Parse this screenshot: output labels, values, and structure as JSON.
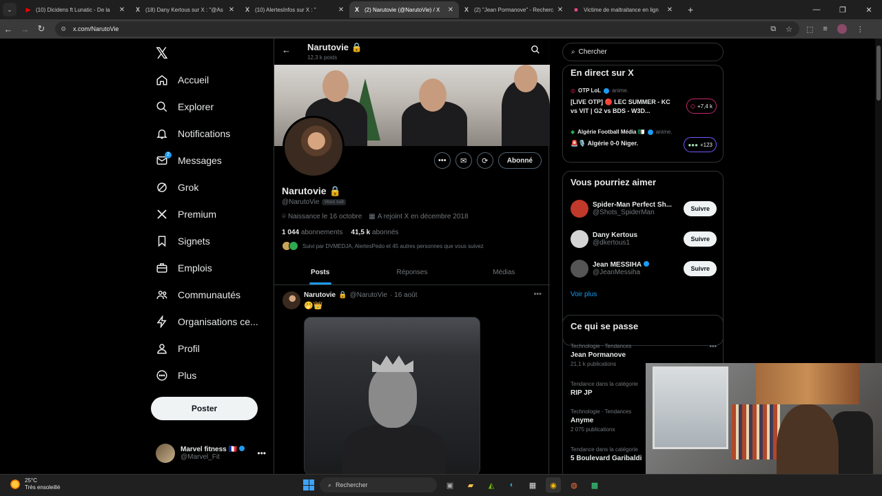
{
  "browser": {
    "tabs": [
      {
        "title": "(10) Dicidens ft Lunatic - De la",
        "favicon": "youtube-icon",
        "color": "#ff0000"
      },
      {
        "title": "(18) Dany Kertous sur X : \"@As",
        "favicon": "x-icon",
        "color": "#ffffff"
      },
      {
        "title": "(10) AlertesInfos sur X : \"",
        "favicon": "x-icon",
        "color": "#ffffff"
      },
      {
        "title": "(2) Narutovie (@NarutoVie) / X",
        "favicon": "x-icon",
        "color": "#ffffff",
        "active": true
      },
      {
        "title": "(2) \"Jean Pormanove\" - Recherc",
        "favicon": "x-icon",
        "color": "#ffffff"
      },
      {
        "title": "Victime de maltraitance en lign",
        "favicon": "document-icon",
        "color": "#e94a8b"
      }
    ],
    "url": "x.com/NarutoVie"
  },
  "nav": {
    "items": [
      {
        "label": "Accueil",
        "icon": "home-icon"
      },
      {
        "label": "Explorer",
        "icon": "search-icon"
      },
      {
        "label": "Notifications",
        "icon": "bell-icon"
      },
      {
        "label": "Messages",
        "icon": "mail-icon",
        "badge": "2"
      },
      {
        "label": "Grok",
        "icon": "grok-icon"
      },
      {
        "label": "Premium",
        "icon": "x-icon"
      },
      {
        "label": "Signets",
        "icon": "bookmark-icon"
      },
      {
        "label": "Emplois",
        "icon": "briefcase-icon"
      },
      {
        "label": "Communautés",
        "icon": "people-icon"
      },
      {
        "label": "Organisations ce...",
        "icon": "lightning-icon"
      },
      {
        "label": "Profil",
        "icon": "person-icon"
      },
      {
        "label": "Plus",
        "icon": "more-circle-icon"
      }
    ],
    "post_label": "Poster",
    "account": {
      "name": "Marvel fitness",
      "flag": "🇫🇷",
      "handle": "@Marvel_Fit"
    }
  },
  "profile": {
    "header_name": "Narutovie",
    "header_posts": "12,3 k posts",
    "name": "Narutovie",
    "handle": "@NarutoVie",
    "follows_you": "Vous suit",
    "birthday": "Naissance le 16 octobre",
    "joined": "A rejoint X en décembre 2018",
    "following_count": "1 044",
    "following_label": "abonnements",
    "followers_count": "41,5 k",
    "followers_label": "abonnés",
    "followed_by": "Suivi par DVMEDJA, AlertesPedo et 45 autres personnes que vous suivez",
    "subscribed_label": "Abonné",
    "tabs": [
      "Posts",
      "Réponses",
      "Médias"
    ]
  },
  "tweet": {
    "author": "Narutovie",
    "handle": "@NarutoVie",
    "date": "· 16 août",
    "text": "🤭👑"
  },
  "right": {
    "search_placeholder": "Chercher",
    "live_title": "En direct sur X",
    "live": [
      {
        "source": "OTP LoL",
        "verb": "anime.",
        "title": "[LIVE OTP] 🔴 LEC SUMMER - KC vs VIT | G2 vs BDS - W3D...",
        "count": "+7,4 k"
      },
      {
        "source": "Algérie Football Média 🇩🇿",
        "verb": "anime.",
        "title": "🚨🎙️ Algérie 0-0 Niger.",
        "count": "+123"
      }
    ],
    "suggest_title": "Vous pourriez aimer",
    "suggestions": [
      {
        "name": "Spider-Man Perfect Sh...",
        "handle": "@Shots_SpiderMan",
        "button": "Suivre",
        "color": "#c0392b"
      },
      {
        "name": "Dany Kertous",
        "handle": "@dkertous1",
        "button": "Suivre",
        "color": "#d4d4d4"
      },
      {
        "name": "Jean MESSIHA",
        "handle": "@JeanMessiha",
        "button": "Suivre",
        "color": "#555555"
      }
    ],
    "voir_plus": "Voir plus",
    "trends_title": "Ce qui se passe",
    "trends": [
      {
        "category": "Technologie · Tendances",
        "name": "Jean Pormanove",
        "count": "21,1 k publications"
      },
      {
        "category": "Tendance dans la catégorie",
        "name": "RIP JP",
        "count": ""
      },
      {
        "category": "Technologie · Tendances",
        "name": "Anyme",
        "count": "2 075 publications"
      },
      {
        "category": "Tendance dans la catégorie",
        "name": "5 Boulevard Garibaldi",
        "count": ""
      }
    ]
  },
  "taskbar": {
    "temp": "25°C",
    "weather": "Très ensoleillé",
    "search": "Rechercher"
  }
}
